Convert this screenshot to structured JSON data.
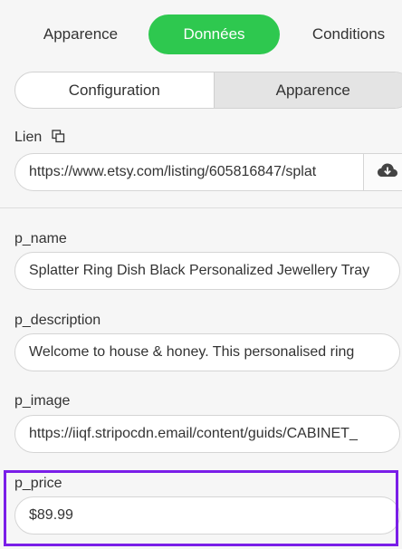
{
  "tabs": {
    "appearance": "Apparence",
    "data": "Données",
    "conditions": "Conditions"
  },
  "segmented": {
    "configuration": "Configuration",
    "appearance": "Apparence"
  },
  "link": {
    "label": "Lien",
    "value": "https://www.etsy.com/listing/605816847/splat"
  },
  "fields": [
    {
      "label": "p_name",
      "value": "Splatter Ring Dish Black Personalized Jewellery Tray"
    },
    {
      "label": "p_description",
      "value": "Welcome to house & honey. This personalised ring"
    },
    {
      "label": "p_image",
      "value": "https://iiqf.stripocdn.email/content/guids/CABINET_"
    },
    {
      "label": "p_price",
      "value": "$89.99"
    }
  ],
  "colors": {
    "active_tab": "#2ec84f",
    "highlight": "#7a1ee8"
  },
  "icons": {
    "link": "copy-link-icon",
    "download": "cloud-download-icon"
  }
}
